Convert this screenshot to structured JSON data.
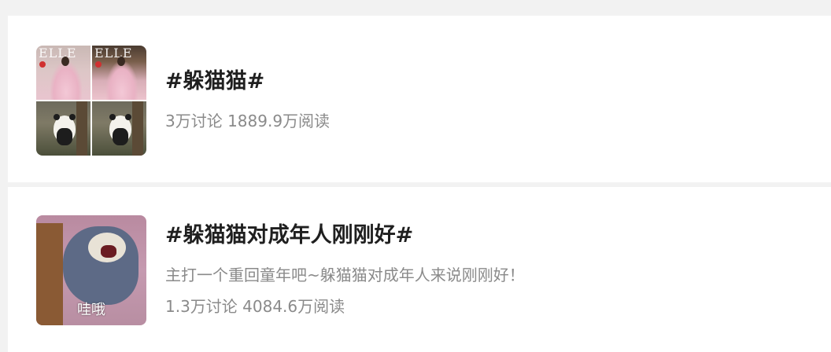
{
  "topics": [
    {
      "title": "#躲猫猫#",
      "stats": "3万讨论 1889.9万阅读",
      "thumbnail": {
        "type": "grid",
        "magazine_mark": "ELLE"
      }
    },
    {
      "title": "#躲猫猫对成年人刚刚好#",
      "description": "主打一个重回童年吧~躲猫猫对成年人来说刚刚好！",
      "stats": "1.3万讨论 4084.6万阅读",
      "thumbnail": {
        "type": "cartoon",
        "caption": "哇哦"
      }
    }
  ],
  "colors": {
    "background": "#f2f2f2",
    "card": "#ffffff",
    "title": "#1f1f1f",
    "secondary_text": "#8a8a8a"
  }
}
